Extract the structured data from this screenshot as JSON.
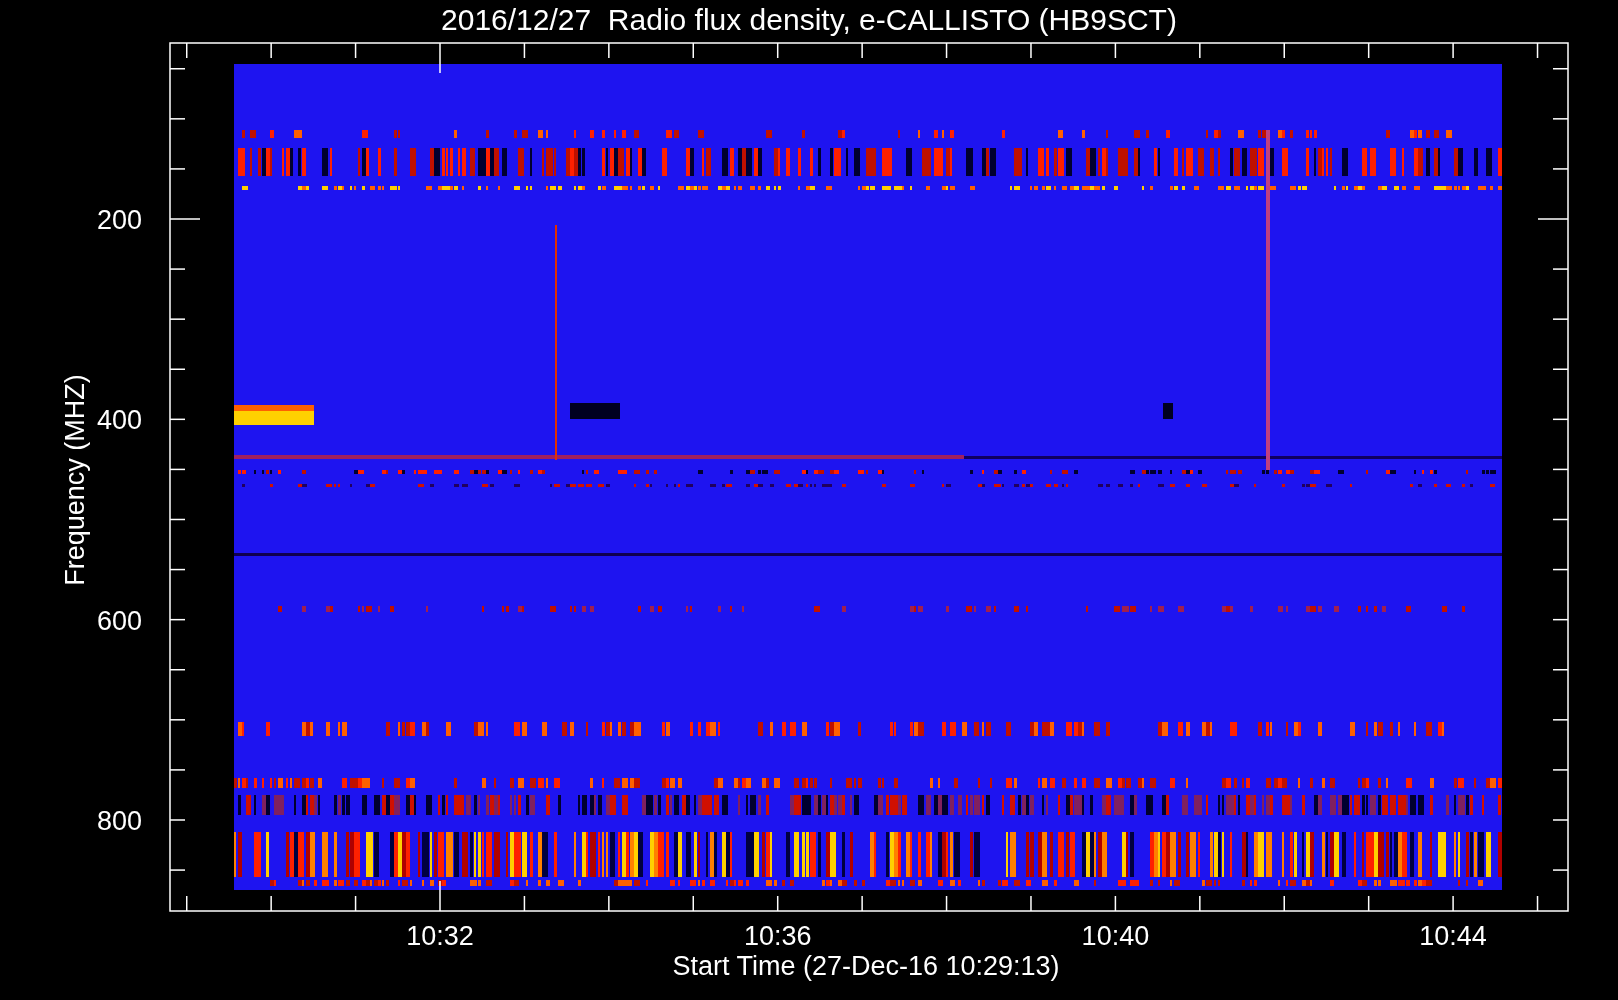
{
  "title": "2016/12/27  Radio flux density, e-CALLISTO (HB9SCT)",
  "y_axis": {
    "label": "Frequency (MHZ)",
    "ticks": [
      "200",
      "400",
      "600",
      "800"
    ]
  },
  "x_axis": {
    "label": "Start Time (27-Dec-16 10:29:13)",
    "ticks": [
      "10:32",
      "10:36",
      "10:40",
      "10:44"
    ]
  }
}
